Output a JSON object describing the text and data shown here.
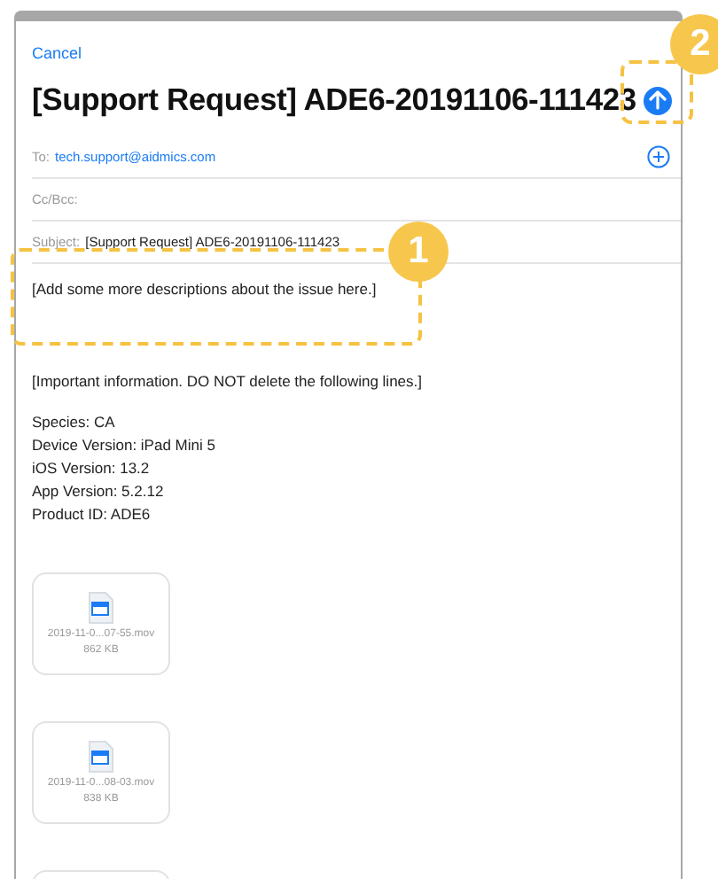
{
  "nav": {
    "cancel": "Cancel"
  },
  "title": "[Support Request] ADE6-20191106-111423",
  "fields": [
    {
      "kind": "to",
      "label": "To:",
      "value": "tech.support@aidmics.com"
    },
    {
      "kind": "cc",
      "label": "Cc/Bcc:"
    },
    {
      "kind": "subject",
      "label": "Subject:",
      "value": "[Support Request] ADE6-20191106-111423"
    }
  ],
  "body": {
    "prompt": "[Add some more descriptions about the issue here.]",
    "notice": "[Important information. DO NOT delete the following lines.]",
    "info_lines": [
      "Species: CA",
      "Device Version: iPad Mini 5",
      "iOS Version: 13.2",
      "App Version: 5.2.12",
      "Product ID: ADE6"
    ]
  },
  "attachments": [
    {
      "kind": "file",
      "name": "2019-11-0...07-55.mov",
      "size": "862 KB"
    },
    {
      "kind": "file",
      "name": "2019-11-0...08-03.mov",
      "size": "838 KB"
    },
    {
      "kind": "partial"
    }
  ],
  "body_callout": {
    "number": "1"
  },
  "send_callout": {
    "number": "2"
  }
}
